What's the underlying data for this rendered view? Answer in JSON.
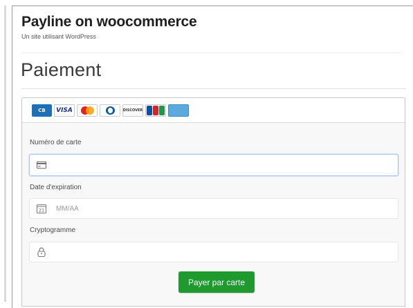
{
  "site": {
    "title": "Payline on woocommerce",
    "description": "Un site utilisant WordPress"
  },
  "page": {
    "title": "Paiement"
  },
  "card_logos": [
    "CB",
    "VISA",
    "MasterCard",
    "Diners Club",
    "DISCOVER",
    "JCB",
    "American Express"
  ],
  "form": {
    "card_number": {
      "label": "Numéro de carte",
      "placeholder": "",
      "icon": "credit-card-icon"
    },
    "expiry": {
      "label": "Date d'expiration",
      "placeholder": "MM/AA",
      "icon": "calendar-icon",
      "calendar_day": "21"
    },
    "cvv": {
      "label": "Cryptogramme",
      "placeholder": "",
      "icon": "lock-icon"
    },
    "submit_label": "Payer par carte"
  },
  "colors": {
    "button": "#1f9a2f",
    "focus_border": "#a9c3f0"
  }
}
